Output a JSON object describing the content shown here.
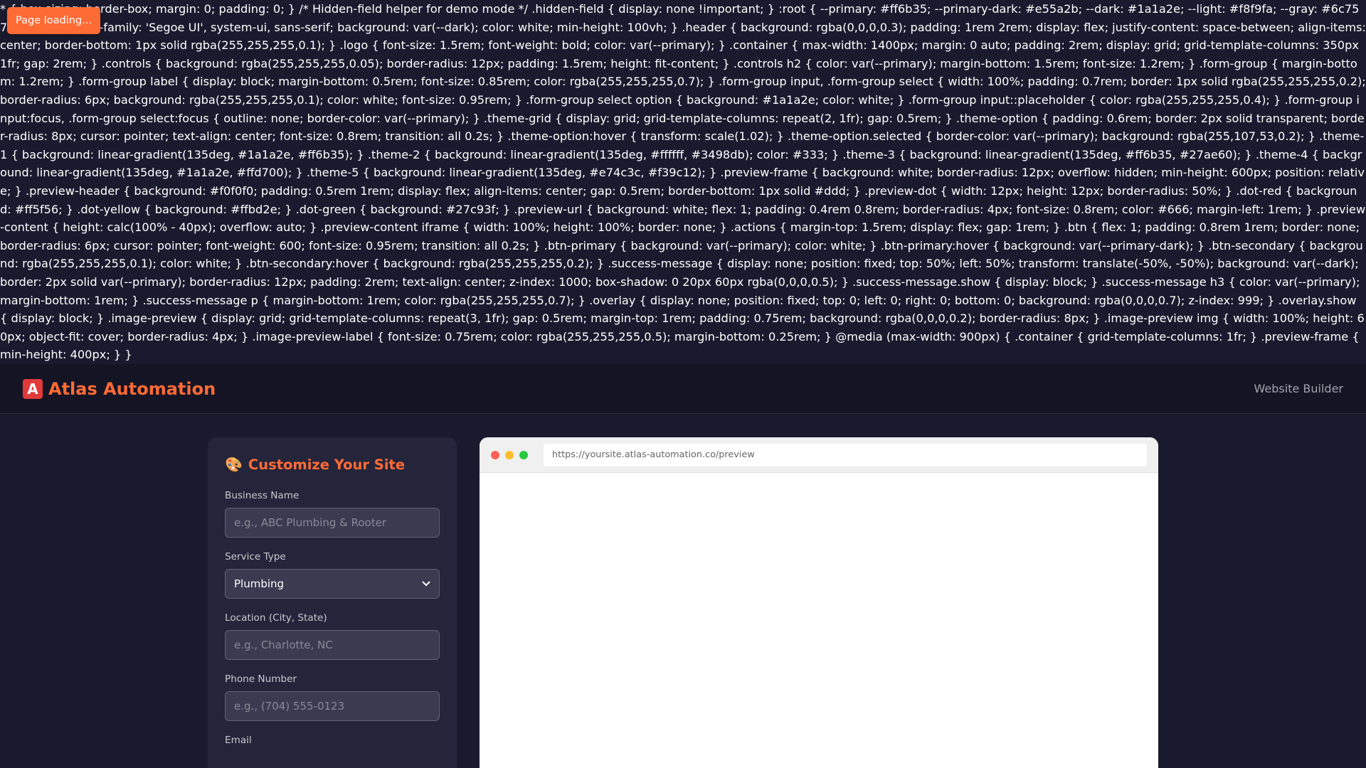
{
  "raw_css_text": "* { box-sizing: border-box; margin: 0; padding: 0; } /* Hidden-field helper for demo mode */ .hidden-field { display: none !important; } :root { --primary: #ff6b35; --primary-dark: #e55a2b; --dark: #1a1a2e; --light: #f8f9fa; --gray: #6c757d; } body { font-family: 'Segoe UI', system-ui, sans-serif; background: var(--dark); color: white; min-height: 100vh; } .header { background: rgba(0,0,0,0.3); padding: 1rem 2rem; display: flex; justify-content: space-between; align-items: center; border-bottom: 1px solid rgba(255,255,255,0.1); } .logo { font-size: 1.5rem; font-weight: bold; color: var(--primary); } .container { max-width: 1400px; margin: 0 auto; padding: 2rem; display: grid; grid-template-columns: 350px 1fr; gap: 2rem; } .controls { background: rgba(255,255,255,0.05); border-radius: 12px; padding: 1.5rem; height: fit-content; } .controls h2 { color: var(--primary); margin-bottom: 1.5rem; font-size: 1.2rem; } .form-group { margin-bottom: 1.2rem; } .form-group label { display: block; margin-bottom: 0.5rem; font-size: 0.85rem; color: rgba(255,255,255,0.7); } .form-group input, .form-group select { width: 100%; padding: 0.7rem; border: 1px solid rgba(255,255,255,0.2); border-radius: 6px; background: rgba(255,255,255,0.1); color: white; font-size: 0.95rem; } .form-group select option { background: #1a1a2e; color: white; } .form-group input::placeholder { color: rgba(255,255,255,0.4); } .form-group input:focus, .form-group select:focus { outline: none; border-color: var(--primary); } .theme-grid { display: grid; grid-template-columns: repeat(2, 1fr); gap: 0.5rem; } .theme-option { padding: 0.6rem; border: 2px solid transparent; border-radius: 8px; cursor: pointer; text-align: center; font-size: 0.8rem; transition: all 0.2s; } .theme-option:hover { transform: scale(1.02); } .theme-option.selected { border-color: var(--primary); background: rgba(255,107,53,0.2); } .theme-1 { background: linear-gradient(135deg, #1a1a2e, #ff6b35); } .theme-2 { background: linear-gradient(135deg, #ffffff, #3498db); color: #333; } .theme-3 { background: linear-gradient(135deg, #ff6b35, #27ae60); } .theme-4 { background: linear-gradient(135deg, #1a1a2e, #ffd700); } .theme-5 { background: linear-gradient(135deg, #e74c3c, #f39c12); } .preview-frame { background: white; border-radius: 12px; overflow: hidden; min-height: 600px; position: relative; } .preview-header { background: #f0f0f0; padding: 0.5rem 1rem; display: flex; align-items: center; gap: 0.5rem; border-bottom: 1px solid #ddd; } .preview-dot { width: 12px; height: 12px; border-radius: 50%; } .dot-red { background: #ff5f56; } .dot-yellow { background: #ffbd2e; } .dot-green { background: #27c93f; } .preview-url { background: white; flex: 1; padding: 0.4rem 0.8rem; border-radius: 4px; font-size: 0.8rem; color: #666; margin-left: 1rem; } .preview-content { height: calc(100% - 40px); overflow: auto; } .preview-content iframe { width: 100%; height: 100%; border: none; } .actions { margin-top: 1.5rem; display: flex; gap: 1rem; } .btn { flex: 1; padding: 0.8rem 1rem; border: none; border-radius: 6px; cursor: pointer; font-weight: 600; font-size: 0.95rem; transition: all 0.2s; } .btn-primary { background: var(--primary); color: white; } .btn-primary:hover { background: var(--primary-dark); } .btn-secondary { background: rgba(255,255,255,0.1); color: white; } .btn-secondary:hover { background: rgba(255,255,255,0.2); } .success-message { display: none; position: fixed; top: 50%; left: 50%; transform: translate(-50%, -50%); background: var(--dark); border: 2px solid var(--primary); border-radius: 12px; padding: 2rem; text-align: center; z-index: 1000; box-shadow: 0 20px 60px rgba(0,0,0,0.5); } .success-message.show { display: block; } .success-message h3 { color: var(--primary); margin-bottom: 1rem; } .success-message p { margin-bottom: 1rem; color: rgba(255,255,255,0.7); } .overlay { display: none; position: fixed; top: 0; left: 0; right: 0; bottom: 0; background: rgba(0,0,0,0.7); z-index: 999; } .overlay.show { display: block; } .image-preview { display: grid; grid-template-columns: repeat(3, 1fr); gap: 0.5rem; margin-top: 1rem; padding: 0.75rem; background: rgba(0,0,0,0.2); border-radius: 8px; } .image-preview img { width: 100%; height: 60px; object-fit: cover; border-radius: 4px; } .image-preview-label { font-size: 0.75rem; color: rgba(255,255,255,0.5); margin-bottom: 0.25rem; } @media (max-width: 900px) { .container { grid-template-columns: 1fr; } .preview-frame { min-height: 400px; } }",
  "toast": {
    "text": "Page loading..."
  },
  "header": {
    "logo_glyph": "A",
    "logo_text": "Atlas Automation",
    "right_text": "Website Builder"
  },
  "controls": {
    "title": "Customize Your Site",
    "fields": {
      "business_name": {
        "label": "Business Name",
        "value": "",
        "placeholder": "e.g., ABC Plumbing & Rooter"
      },
      "service_type": {
        "label": "Service Type",
        "selected": "Plumbing"
      },
      "location": {
        "label": "Location (City, State)",
        "value": "",
        "placeholder": "e.g., Charlotte, NC"
      },
      "phone": {
        "label": "Phone Number",
        "value": "",
        "placeholder": "e.g., (704) 555-0123"
      },
      "email": {
        "label": "Email"
      }
    }
  },
  "preview": {
    "url": "https://yoursite.atlas-automation.co/preview"
  },
  "colors": {
    "primary": "#ff6b35",
    "dark": "#1a1a2e"
  }
}
